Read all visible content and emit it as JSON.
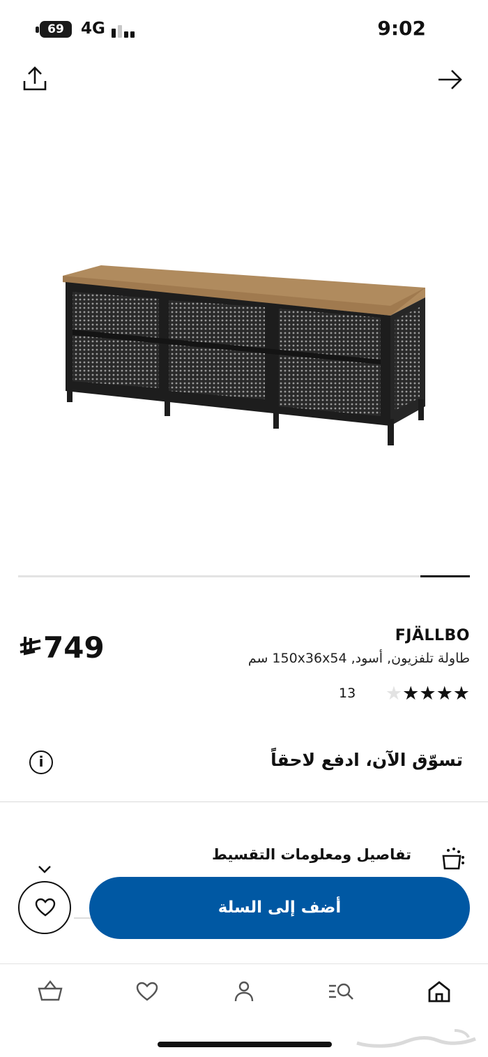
{
  "status_bar": {
    "battery": "69",
    "network": "4G",
    "time": "9:02"
  },
  "toolbar": {
    "share_icon": "share-icon",
    "forward_icon": "arrow-right-icon"
  },
  "gallery": {
    "image_alt": "FJÄLLBO",
    "progress": 0.11
  },
  "product": {
    "brand": "FJÄLLBO",
    "description": "طاولة تلفزيون, أسود, 150x36x54 سم",
    "price": "749",
    "currency_symbol": "riyal-symbol",
    "rating": 4,
    "rating_max": 5,
    "reviews_count": "13"
  },
  "payment": {
    "bnpl_text": "تسوّق الآن، ادفع لاحقاً",
    "info_icon": "info-icon",
    "installment_label": "تفاصيل ومعلومات التقسيط",
    "installment_icon": "installment-icon"
  },
  "actions": {
    "add_to_cart": "أضف إلى السلة",
    "favorite_icon": "heart-icon"
  },
  "bottom_nav": {
    "items": [
      {
        "name": "cart-icon"
      },
      {
        "name": "heart-icon"
      },
      {
        "name": "profile-icon"
      },
      {
        "name": "search-icon"
      },
      {
        "name": "home-icon"
      }
    ],
    "active": "home-icon"
  },
  "watermark": "حراج",
  "colors": {
    "accent": "#0058a3",
    "text": "#111111",
    "star_empty": "#e3e3e3"
  }
}
